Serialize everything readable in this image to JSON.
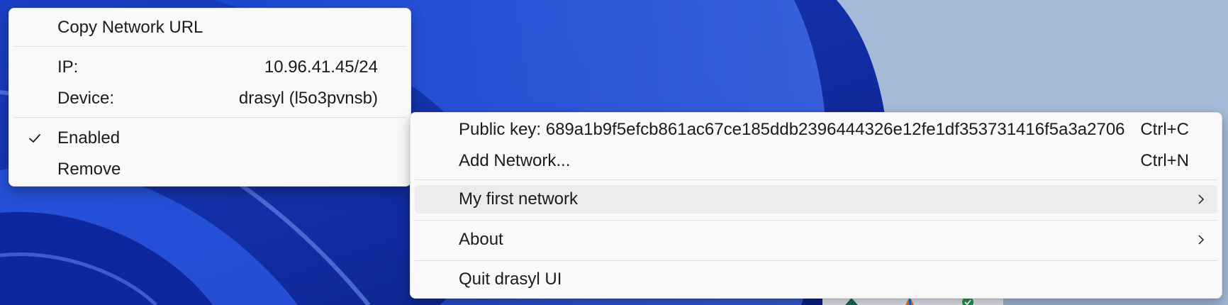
{
  "submenu": {
    "copy_url": "Copy Network URL",
    "ip_label": "IP:",
    "ip_value": "10.96.41.45/24",
    "device_label": "Device:",
    "device_value": "drasyl (l5o3pvnsb)",
    "enabled_label": "Enabled",
    "enabled_checked": true,
    "remove_label": "Remove"
  },
  "main_menu": {
    "public_key": "Public key: 689a1b9f5efcb861ac67ce185ddb2396444326e12fe1df353731416f5a3a2706",
    "public_key_shortcut": "Ctrl+C",
    "add_network": "Add Network...",
    "add_network_shortcut": "Ctrl+N",
    "network_item": "My first network",
    "about": "About",
    "quit": "Quit drasyl UI"
  },
  "icons": {
    "check": "checkmark-icon",
    "submenu_arrow": "chevron-right-icon"
  },
  "colors": {
    "menu_bg": "#f9f9f9",
    "hover_bg": "#ececec",
    "wallpaper_dark": "#0d2a9c",
    "wallpaper_light": "#a4bad8"
  }
}
